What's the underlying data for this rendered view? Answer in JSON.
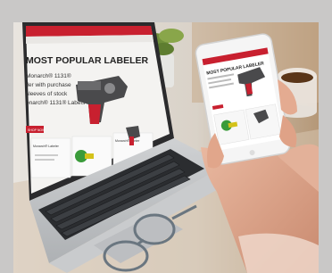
{
  "laptop_screen": {
    "headline": "MOST POPULAR LABELER",
    "body_lines": [
      "Monarch® 1131®",
      "ller with purchase",
      "sleeves of stock",
      "onarch® 1131® Labels"
    ],
    "button_label": "SHOP NOW",
    "card1_title": "Monarch® Labeler",
    "card2_title": "Monarch® Printer"
  },
  "phone_screen": {
    "headline": "MOST POPULAR LABELER"
  },
  "colors": {
    "brand_red": "#c8202f",
    "frame_gray": "#c9c8c7"
  }
}
